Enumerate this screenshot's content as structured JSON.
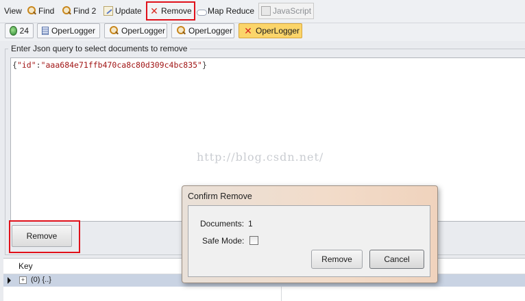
{
  "toolbar": {
    "view": "View",
    "find": "Find",
    "find2": "Find 2",
    "update": "Update",
    "remove": "Remove",
    "map_reduce": "Map Reduce",
    "javascript": "JavaScript",
    "highlight_color": "#e0101a"
  },
  "tabs": [
    {
      "label": "24",
      "icon": "globe-icon"
    },
    {
      "label": "OperLogger",
      "icon": "table-icon"
    },
    {
      "label": "OperLogger",
      "icon": "search-icon"
    },
    {
      "label": "OperLogger",
      "icon": "search-icon"
    },
    {
      "label": "OperLogger",
      "icon": "remove-icon",
      "selected": true
    }
  ],
  "query": {
    "group_label": "Enter Json query to select documents to remove",
    "open": "{",
    "key": "\"id\"",
    "colon": ":",
    "value": "\"aaa684e71ffb470ca8c80d309c4bc835\"",
    "close": "}",
    "watermark": "http://blog.csdn.net/"
  },
  "main": {
    "remove_button": "Remove"
  },
  "grid": {
    "column_key": "Key",
    "rows": [
      {
        "text": "(0) {..}"
      }
    ]
  },
  "dialog": {
    "title": "Confirm Remove",
    "documents_label": "Documents:",
    "documents_value": "1",
    "safe_mode_label": "Safe Mode:",
    "safe_mode_checked": false,
    "remove_button": "Remove",
    "cancel_button": "Cancel"
  }
}
